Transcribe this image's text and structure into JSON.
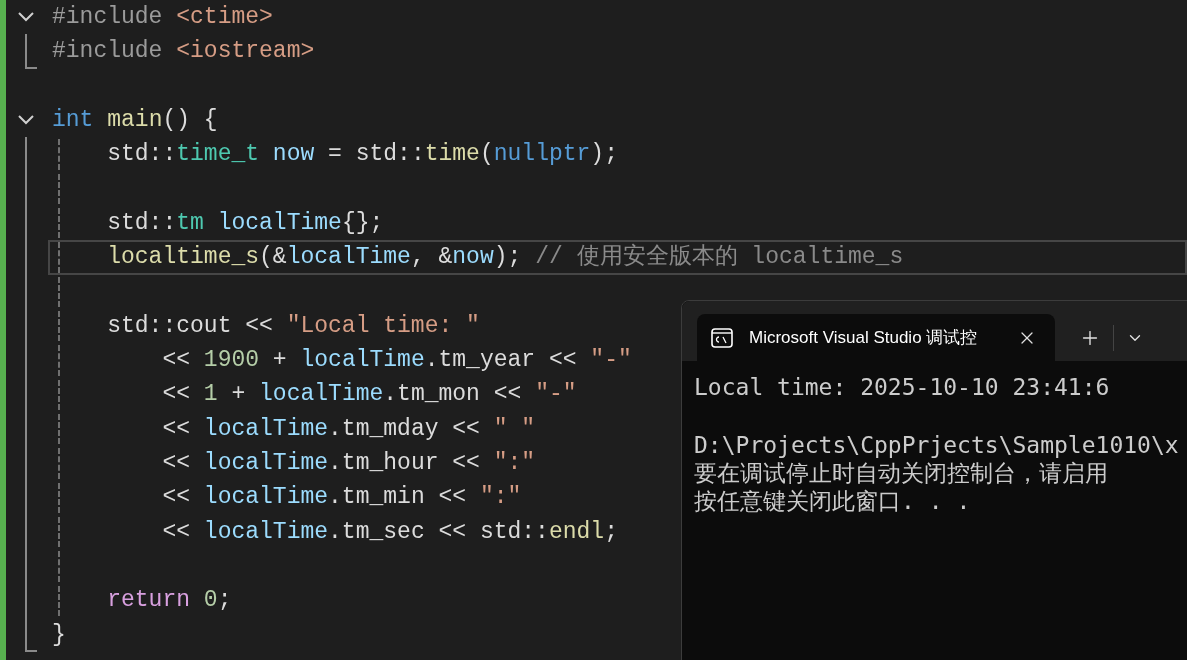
{
  "editor": {
    "lines": [
      {
        "kind": "fold-start",
        "expanded": true,
        "current": false,
        "guide": false,
        "tokens": [
          {
            "text": "#include",
            "kind": "preproc"
          },
          {
            "text": " <ctime>",
            "kind": "string"
          }
        ]
      },
      {
        "kind": "fold-end",
        "current": false,
        "guide": false,
        "tokens": [
          {
            "text": "#include",
            "kind": "preproc"
          },
          {
            "text": " <iostream>",
            "kind": "string"
          }
        ]
      },
      {
        "kind": "blank",
        "current": false,
        "guide": false
      },
      {
        "kind": "fold-start",
        "expanded": true,
        "current": false,
        "guide": false,
        "tokens": [
          {
            "text": "int",
            "kind": "keyword"
          },
          {
            "text": " main",
            "kind": "func"
          },
          {
            "text": "() {",
            "kind": "plain"
          }
        ]
      },
      {
        "kind": "fold-body",
        "current": false,
        "guide": true,
        "tokens": [
          {
            "text": "    std::",
            "kind": "plain"
          },
          {
            "text": "time_t",
            "kind": "type"
          },
          {
            "text": " now",
            "kind": "var"
          },
          {
            "text": " = std::",
            "kind": "plain"
          },
          {
            "text": "time",
            "kind": "func"
          },
          {
            "text": "(",
            "kind": "plain"
          },
          {
            "text": "nullptr",
            "kind": "keyword"
          },
          {
            "text": ");",
            "kind": "plain"
          }
        ]
      },
      {
        "kind": "fold-body",
        "current": false,
        "guide": true
      },
      {
        "kind": "fold-body",
        "current": false,
        "guide": true,
        "tokens": [
          {
            "text": "    std::",
            "kind": "plain"
          },
          {
            "text": "tm",
            "kind": "type"
          },
          {
            "text": " localTime",
            "kind": "var"
          },
          {
            "text": "{};",
            "kind": "plain"
          }
        ]
      },
      {
        "kind": "fold-body",
        "current": true,
        "guide": true,
        "tokens": [
          {
            "text": "    localtime_s",
            "kind": "func"
          },
          {
            "text": "(&",
            "kind": "plain"
          },
          {
            "text": "localTime",
            "kind": "var"
          },
          {
            "text": ", &",
            "kind": "plain"
          },
          {
            "text": "now",
            "kind": "var"
          },
          {
            "text": "); ",
            "kind": "plain"
          },
          {
            "text": "// 使用安全版本的 localtime_s",
            "kind": "comment"
          }
        ]
      },
      {
        "kind": "fold-body",
        "current": false,
        "guide": true
      },
      {
        "kind": "fold-body",
        "current": false,
        "guide": true,
        "tokens": [
          {
            "text": "    std::cout << ",
            "kind": "plain"
          },
          {
            "text": "\"Local time: \"",
            "kind": "string"
          }
        ]
      },
      {
        "kind": "fold-body",
        "current": false,
        "guide": true,
        "tokens": [
          {
            "text": "        << ",
            "kind": "plain"
          },
          {
            "text": "1900",
            "kind": "number"
          },
          {
            "text": " + ",
            "kind": "plain"
          },
          {
            "text": "localTime",
            "kind": "var"
          },
          {
            "text": ".tm_year << ",
            "kind": "plain"
          },
          {
            "text": "\"-\"",
            "kind": "string"
          }
        ]
      },
      {
        "kind": "fold-body",
        "current": false,
        "guide": true,
        "tokens": [
          {
            "text": "        << ",
            "kind": "plain"
          },
          {
            "text": "1",
            "kind": "number"
          },
          {
            "text": " + ",
            "kind": "plain"
          },
          {
            "text": "localTime",
            "kind": "var"
          },
          {
            "text": ".tm_mon << ",
            "kind": "plain"
          },
          {
            "text": "\"-\"",
            "kind": "string"
          }
        ]
      },
      {
        "kind": "fold-body",
        "current": false,
        "guide": true,
        "tokens": [
          {
            "text": "        << ",
            "kind": "plain"
          },
          {
            "text": "localTime",
            "kind": "var"
          },
          {
            "text": ".tm_mday << ",
            "kind": "plain"
          },
          {
            "text": "\" \"",
            "kind": "string"
          }
        ]
      },
      {
        "kind": "fold-body",
        "current": false,
        "guide": true,
        "tokens": [
          {
            "text": "        << ",
            "kind": "plain"
          },
          {
            "text": "localTime",
            "kind": "var"
          },
          {
            "text": ".tm_hour << ",
            "kind": "plain"
          },
          {
            "text": "\":\"",
            "kind": "string"
          }
        ]
      },
      {
        "kind": "fold-body",
        "current": false,
        "guide": true,
        "tokens": [
          {
            "text": "        << ",
            "kind": "plain"
          },
          {
            "text": "localTime",
            "kind": "var"
          },
          {
            "text": ".tm_min << ",
            "kind": "plain"
          },
          {
            "text": "\":\"",
            "kind": "string"
          }
        ]
      },
      {
        "kind": "fold-body",
        "current": false,
        "guide": true,
        "tokens": [
          {
            "text": "        << ",
            "kind": "plain"
          },
          {
            "text": "localTime",
            "kind": "var"
          },
          {
            "text": ".tm_sec << std::",
            "kind": "plain"
          },
          {
            "text": "endl",
            "kind": "func"
          },
          {
            "text": ";",
            "kind": "plain"
          }
        ]
      },
      {
        "kind": "fold-body",
        "current": false,
        "guide": true
      },
      {
        "kind": "fold-body",
        "current": false,
        "guide": true,
        "tokens": [
          {
            "text": "    return",
            "kind": "control"
          },
          {
            "text": " 0",
            "kind": "number"
          },
          {
            "text": ";",
            "kind": "plain"
          }
        ]
      },
      {
        "kind": "fold-end",
        "current": false,
        "guide": false,
        "tokens": [
          {
            "text": "}",
            "kind": "plain"
          }
        ]
      }
    ]
  },
  "console": {
    "tab": {
      "title": "Microsoft Visual Studio 调试控",
      "selected": true
    },
    "lines": [
      {
        "kind": "text",
        "text": "Local time: 2025-10-10 23:41:6"
      },
      {
        "kind": "blank"
      },
      {
        "kind": "text",
        "text": "D:\\Projects\\CppPrjects\\Sample1010\\x"
      },
      {
        "kind": "text",
        "text": "要在调试停止时自动关闭控制台，请启用"
      },
      {
        "kind": "text",
        "text": "按任意键关闭此窗口. . ."
      }
    ]
  }
}
